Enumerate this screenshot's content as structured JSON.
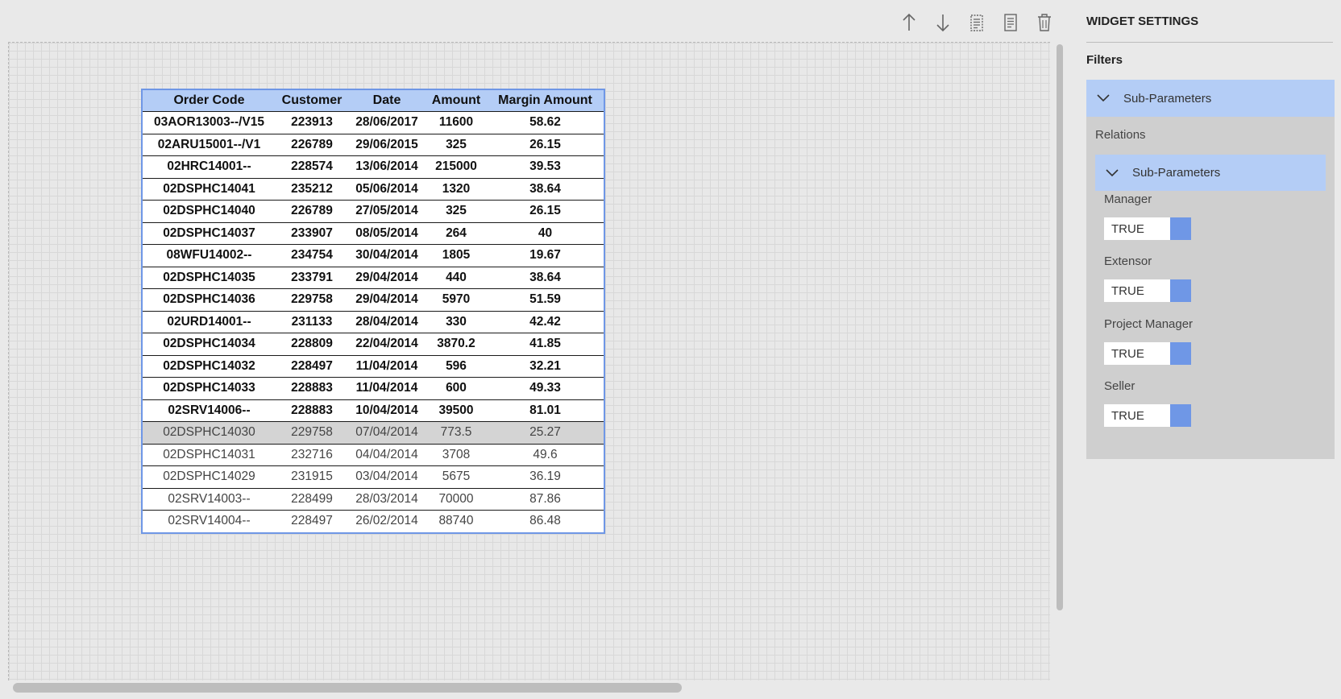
{
  "toolbar": {
    "icons": [
      "arrow-up-icon",
      "arrow-down-icon",
      "duplicate-icon",
      "document-icon",
      "trash-icon"
    ]
  },
  "table": {
    "columns": [
      "Order Code",
      "Customer",
      "Date",
      "Amount",
      "Margin Amount"
    ],
    "rows": [
      {
        "style": "bold",
        "cells": [
          "03AOR13003--/V15",
          "223913",
          "28/06/2017",
          "11600",
          "58.62"
        ]
      },
      {
        "style": "bold",
        "cells": [
          "02ARU15001--/V1",
          "226789",
          "29/06/2015",
          "325",
          "26.15"
        ]
      },
      {
        "style": "bold",
        "cells": [
          "02HRC14001--",
          "228574",
          "13/06/2014",
          "215000",
          "39.53"
        ]
      },
      {
        "style": "bold",
        "cells": [
          "02DSPHC14041",
          "235212",
          "05/06/2014",
          "1320",
          "38.64"
        ]
      },
      {
        "style": "bold",
        "cells": [
          "02DSPHC14040",
          "226789",
          "27/05/2014",
          "325",
          "26.15"
        ]
      },
      {
        "style": "bold",
        "cells": [
          "02DSPHC14037",
          "233907",
          "08/05/2014",
          "264",
          "40"
        ]
      },
      {
        "style": "bold",
        "cells": [
          "08WFU14002--",
          "234754",
          "30/04/2014",
          "1805",
          "19.67"
        ]
      },
      {
        "style": "bold",
        "cells": [
          "02DSPHC14035",
          "233791",
          "29/04/2014",
          "440",
          "38.64"
        ]
      },
      {
        "style": "bold",
        "cells": [
          "02DSPHC14036",
          "229758",
          "29/04/2014",
          "5970",
          "51.59"
        ]
      },
      {
        "style": "bold",
        "cells": [
          "02URD14001--",
          "231133",
          "28/04/2014",
          "330",
          "42.42"
        ]
      },
      {
        "style": "bold",
        "cells": [
          "02DSPHC14034",
          "228809",
          "22/04/2014",
          "3870.2",
          "41.85"
        ]
      },
      {
        "style": "bold",
        "cells": [
          "02DSPHC14032",
          "228497",
          "11/04/2014",
          "596",
          "32.21"
        ]
      },
      {
        "style": "bold",
        "cells": [
          "02DSPHC14033",
          "228883",
          "11/04/2014",
          "600",
          "49.33"
        ]
      },
      {
        "style": "bold",
        "cells": [
          "02SRV14006--",
          "228883",
          "10/04/2014",
          "39500",
          "81.01"
        ]
      },
      {
        "style": "normal selected",
        "cells": [
          "02DSPHC14030",
          "229758",
          "07/04/2014",
          "773.5",
          "25.27"
        ]
      },
      {
        "style": "normal",
        "cells": [
          "02DSPHC14031",
          "232716",
          "04/04/2014",
          "3708",
          "49.6"
        ]
      },
      {
        "style": "normal",
        "cells": [
          "02DSPHC14029",
          "231915",
          "03/04/2014",
          "5675",
          "36.19"
        ]
      },
      {
        "style": "normal",
        "cells": [
          "02SRV14003--",
          "228499",
          "28/03/2014",
          "70000",
          "87.86"
        ]
      },
      {
        "style": "normal",
        "cells": [
          "02SRV14004--",
          "228497",
          "26/02/2014",
          "88740",
          "86.48"
        ]
      }
    ]
  },
  "panel": {
    "title": "WIDGET SETTINGS",
    "filters_label": "Filters",
    "outer_accordion": "Sub-Parameters",
    "relations_label": "Relations",
    "inner_accordion": "Sub-Parameters",
    "fields": [
      {
        "label": "Manager",
        "value": "TRUE"
      },
      {
        "label": "Extensor",
        "value": "TRUE"
      },
      {
        "label": "Project Manager",
        "value": "TRUE"
      },
      {
        "label": "Seller",
        "value": "TRUE"
      }
    ]
  },
  "colors": {
    "accent": "#6f97e6",
    "header_bg": "#b4cdf6",
    "selected_row": "#d4d4d4"
  }
}
